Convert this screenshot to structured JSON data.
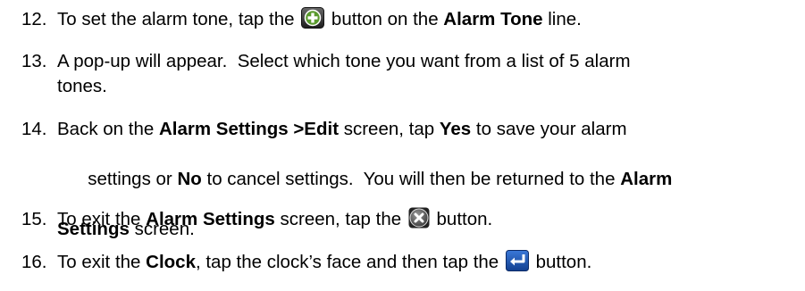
{
  "steps": [
    {
      "number": "12.",
      "parts": [
        {
          "t": "text",
          "v": "To set the alarm tone, tap the "
        },
        {
          "t": "icon",
          "v": "plus-icon"
        },
        {
          "t": "text",
          "v": " button on the "
        },
        {
          "t": "bold",
          "v": "Alarm Tone"
        },
        {
          "t": "text",
          "v": " line."
        }
      ]
    },
    {
      "number": "13.",
      "lines": [
        "A pop-up will appear.  Select which tone you want from a list of 5 alarm",
        "tones."
      ]
    },
    {
      "number": "14.",
      "line1": [
        {
          "t": "text",
          "v": "Back on the "
        },
        {
          "t": "bold",
          "v": "Alarm Settings >Edit"
        },
        {
          "t": "text",
          "v": " screen, tap "
        },
        {
          "t": "bold",
          "v": "Yes"
        },
        {
          "t": "text",
          "v": " to save your alarm"
        }
      ],
      "line2": [
        {
          "t": "text",
          "v": "settings or "
        },
        {
          "t": "bold",
          "v": "No"
        },
        {
          "t": "text",
          "v": " to cancel settings.  You will then be returned to the "
        },
        {
          "t": "bold",
          "v": "Alarm"
        }
      ],
      "line3": [
        {
          "t": "bold",
          "v": "Settings"
        },
        {
          "t": "text",
          "v": " screen."
        }
      ]
    },
    {
      "number": "15.",
      "parts": [
        {
          "t": "text",
          "v": "To exit the "
        },
        {
          "t": "bold",
          "v": "Alarm Settings"
        },
        {
          "t": "text",
          "v": " screen, tap the "
        },
        {
          "t": "icon",
          "v": "close-icon"
        },
        {
          "t": "text",
          "v": " button."
        }
      ]
    },
    {
      "number": "16.",
      "parts": [
        {
          "t": "text",
          "v": "To exit the "
        },
        {
          "t": "bold",
          "v": "Clock"
        },
        {
          "t": "text",
          "v": ", tap the clock’s face and then tap the "
        },
        {
          "t": "icon",
          "v": "return-icon"
        },
        {
          "t": "text",
          "v": " button."
        }
      ]
    }
  ]
}
